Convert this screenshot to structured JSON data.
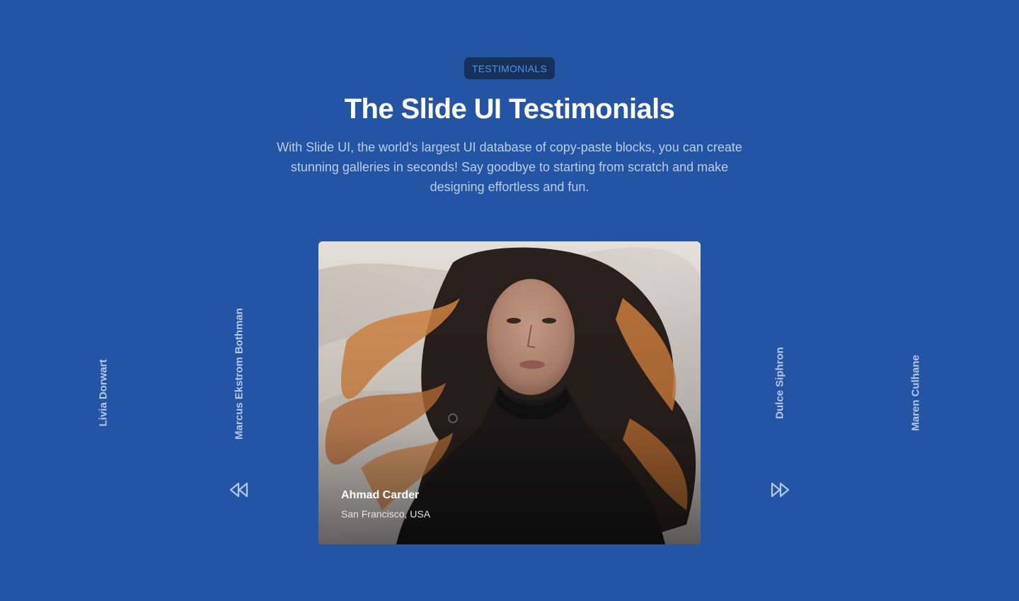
{
  "section": {
    "badge": "TESTIMONIALS",
    "title": "The Slide UI Testimonials",
    "description": "With Slide UI, the world's largest UI database of copy-paste blocks, you can create stunning galleries in seconds! Say goodbye to starting from scratch and make designing effortless and fun."
  },
  "slider": {
    "active": {
      "name": "Ahmad Carder",
      "location": "San Francisco, USA",
      "image_alt": "woman-with-flowing-hair-photo"
    },
    "left_names": [
      "Livia Dorwart",
      "Marcus Ekstrom Bothman"
    ],
    "right_names": [
      "Dulce Siphron",
      "Maren Culhane"
    ],
    "prev_icon": "rewind-icon",
    "next_icon": "fast-forward-icon"
  },
  "colors": {
    "background": "#2455a4",
    "badge_bg": "#17305a",
    "badge_text": "#4d94ea",
    "title": "#ffffff",
    "muted_text": "#b4c8ea"
  }
}
